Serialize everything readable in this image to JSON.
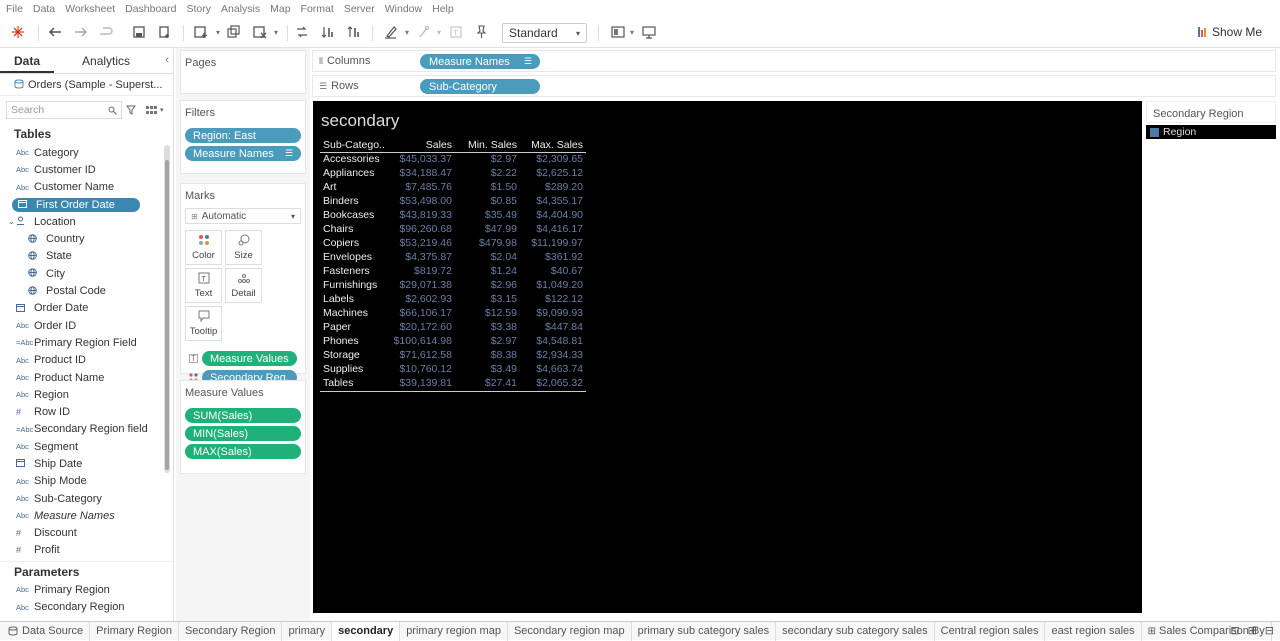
{
  "menu": [
    "File",
    "Data",
    "Worksheet",
    "Dashboard",
    "Story",
    "Analysis",
    "Map",
    "Format",
    "Server",
    "Window",
    "Help"
  ],
  "toolbar": {
    "fit_value": "Standard",
    "show_me": "Show Me"
  },
  "pane_tabs": {
    "data": "Data",
    "analytics": "Analytics"
  },
  "datasource": "Orders (Sample - Superst...",
  "search_placeholder": "Search",
  "tables_header": "Tables",
  "fields": [
    {
      "icon": "Abc",
      "name": "Category"
    },
    {
      "icon": "Abc",
      "name": "Customer ID"
    },
    {
      "icon": "Abc",
      "name": "Customer Name"
    },
    {
      "icon": "cal",
      "name": "First Order Date",
      "selected": true
    },
    {
      "icon": "geo",
      "name": "Location",
      "group": true
    },
    {
      "icon": "glb",
      "name": "Country",
      "indent": true
    },
    {
      "icon": "glb",
      "name": "State",
      "indent": true
    },
    {
      "icon": "glb",
      "name": "City",
      "indent": true
    },
    {
      "icon": "glb",
      "name": "Postal Code",
      "indent": true
    },
    {
      "icon": "cal",
      "name": "Order Date"
    },
    {
      "icon": "Abc",
      "name": "Order ID"
    },
    {
      "icon": "=Abc",
      "name": "Primary Region Field"
    },
    {
      "icon": "Abc",
      "name": "Product ID"
    },
    {
      "icon": "Abc",
      "name": "Product Name"
    },
    {
      "icon": "Abc",
      "name": "Region"
    },
    {
      "icon": "#",
      "name": "Row ID"
    },
    {
      "icon": "=Abc",
      "name": "Secondary Region field"
    },
    {
      "icon": "Abc",
      "name": "Segment"
    },
    {
      "icon": "cal",
      "name": "Ship Date"
    },
    {
      "icon": "Abc",
      "name": "Ship Mode"
    },
    {
      "icon": "Abc",
      "name": "Sub-Category"
    },
    {
      "icon": "Abc",
      "name": "Measure Names",
      "italic": true
    },
    {
      "icon": "#",
      "name": "Discount"
    },
    {
      "icon": "#",
      "name": "Profit"
    }
  ],
  "parameters_header": "Parameters",
  "parameters": [
    {
      "icon": "Abc",
      "name": "Primary Region"
    },
    {
      "icon": "Abc",
      "name": "Secondary Region"
    }
  ],
  "pages_label": "Pages",
  "filters_label": "Filters",
  "filters": [
    "Region: East",
    "Measure Names"
  ],
  "marks_label": "Marks",
  "marks_type": "Automatic",
  "mark_buttons": [
    "Color",
    "Size",
    "Text",
    "Detail",
    "Tooltip"
  ],
  "mark_pills": [
    "Measure Values",
    "Secondary Reg.."
  ],
  "measure_values_label": "Measure Values",
  "measure_values": [
    "SUM(Sales)",
    "MIN(Sales)",
    "MAX(Sales)"
  ],
  "columns_label": "Columns",
  "columns_pill": "Measure Names",
  "rows_label": "Rows",
  "rows_pill": "Sub-Category",
  "view": {
    "title": "secondary",
    "headers": [
      "Sub-Catego..",
      "Sales",
      "Min. Sales",
      "Max. Sales"
    ],
    "rows": [
      [
        "Accessories",
        "$45,033.37",
        "$2.97",
        "$2,309.65"
      ],
      [
        "Appliances",
        "$34,188.47",
        "$2.22",
        "$2,625.12"
      ],
      [
        "Art",
        "$7,485.76",
        "$1.50",
        "$289.20"
      ],
      [
        "Binders",
        "$53,498.00",
        "$0.85",
        "$4,355.17"
      ],
      [
        "Bookcases",
        "$43,819.33",
        "$35.49",
        "$4,404.90"
      ],
      [
        "Chairs",
        "$96,260.68",
        "$47.99",
        "$4,416.17"
      ],
      [
        "Copiers",
        "$53,219.46",
        "$479.98",
        "$11,199.97"
      ],
      [
        "Envelopes",
        "$4,375.87",
        "$2.04",
        "$361.92"
      ],
      [
        "Fasteners",
        "$819.72",
        "$1.24",
        "$40.67"
      ],
      [
        "Furnishings",
        "$29,071.38",
        "$2.96",
        "$1,049.20"
      ],
      [
        "Labels",
        "$2,602.93",
        "$3.15",
        "$122.12"
      ],
      [
        "Machines",
        "$66,106.17",
        "$12.59",
        "$9,099.93"
      ],
      [
        "Paper",
        "$20,172.60",
        "$3.38",
        "$447.84"
      ],
      [
        "Phones",
        "$100,614.98",
        "$2.97",
        "$4,548.81"
      ],
      [
        "Storage",
        "$71,612.58",
        "$8.38",
        "$2,934.33"
      ],
      [
        "Supplies",
        "$10,760.12",
        "$3.49",
        "$4,663.74"
      ],
      [
        "Tables",
        "$39,139.81",
        "$27.41",
        "$2,065.32"
      ]
    ]
  },
  "legend": {
    "title": "Secondary Region",
    "item": "Region",
    "color": "#4e79a7"
  },
  "bottom_tabs": [
    "Data Source",
    "Primary Region",
    "Secondary Region",
    "primary",
    "secondary",
    "primary region map",
    "Secondary region map",
    "primary sub  category sales",
    "secondary sub category sales",
    "Central region sales",
    "east region sales",
    "Sales Comparison By"
  ],
  "active_tab": "secondary"
}
